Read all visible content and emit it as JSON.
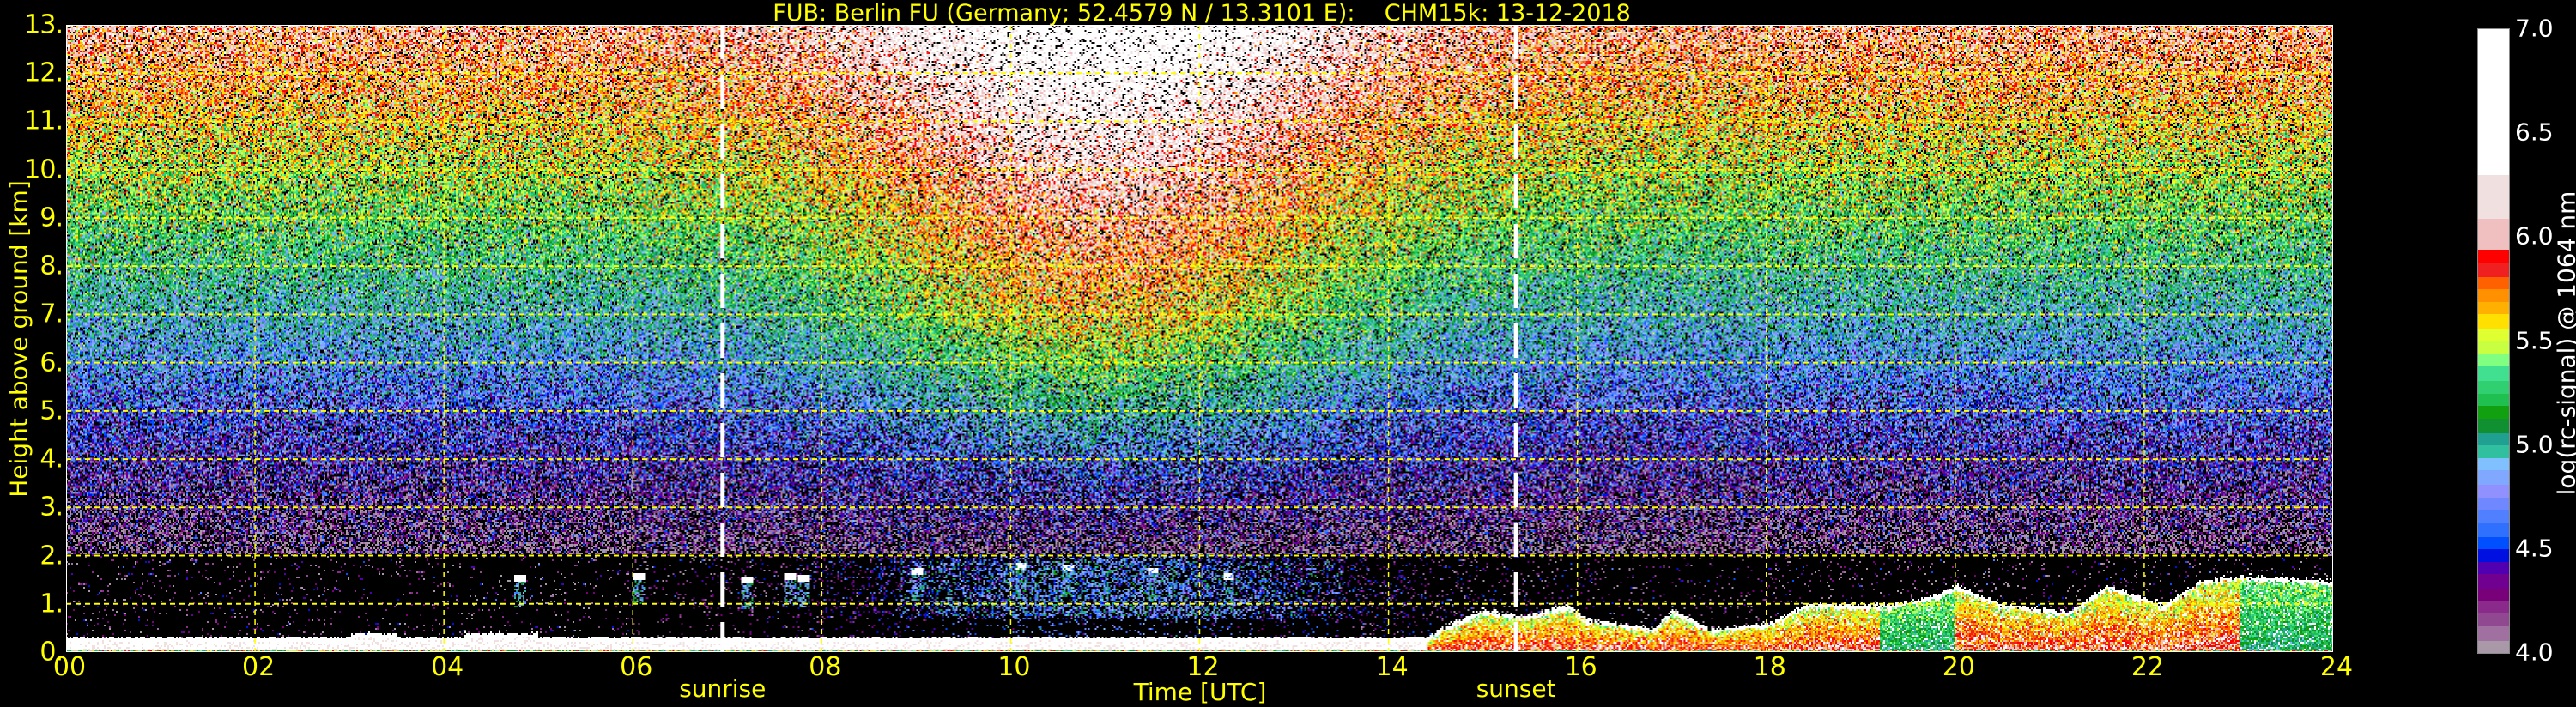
{
  "chart_data": {
    "type": "heatmap",
    "title": "FUB: Berlin FU (Germany; 52.4579 N / 13.3101 E):    CHM15k: 13-12-2018",
    "xlabel": "Time [UTC]",
    "ylabel": "Height above ground [km]",
    "xlim": [
      0,
      24
    ],
    "ylim": [
      0,
      13
    ],
    "xticks": [
      "00",
      "02",
      "04",
      "06",
      "08",
      "10",
      "12",
      "14",
      "16",
      "18",
      "20",
      "22",
      "24"
    ],
    "xtick_values": [
      0,
      2,
      4,
      6,
      8,
      10,
      12,
      14,
      16,
      18,
      20,
      22,
      24
    ],
    "yticks": [
      "0.",
      "1.",
      "2.",
      "3.",
      "4.",
      "5.",
      "6.",
      "7.",
      "8.",
      "9.",
      "10.",
      "11.",
      "12.",
      "13."
    ],
    "ytick_values": [
      0,
      1,
      2,
      3,
      4,
      5,
      6,
      7,
      8,
      9,
      10,
      11,
      12,
      13
    ],
    "grid": true,
    "grid_color": "#ffff00",
    "annotations": [
      {
        "label": "sunrise",
        "time": 6.95
      },
      {
        "label": "sunset",
        "time": 15.35
      }
    ],
    "colorbar": {
      "label": "log(rc-signal) @ 1064 nm",
      "range": [
        4.0,
        7.0
      ],
      "ticks": [
        "4.0",
        "4.5",
        "5.0",
        "5.5",
        "6.0",
        "6.5",
        "7.0"
      ],
      "tick_values": [
        4.0,
        4.5,
        5.0,
        5.5,
        6.0,
        6.5,
        7.0
      ],
      "levels": [
        {
          "from": 4.0,
          "color": "#a898a8"
        },
        {
          "from": 4.06,
          "color": "#a070a0"
        },
        {
          "from": 4.13,
          "color": "#904890"
        },
        {
          "from": 4.19,
          "color": "#8a2a8a"
        },
        {
          "from": 4.25,
          "color": "#780078"
        },
        {
          "from": 4.31,
          "color": "#700090"
        },
        {
          "from": 4.38,
          "color": "#5000b0"
        },
        {
          "from": 4.44,
          "color": "#0010e0"
        },
        {
          "from": 4.5,
          "color": "#0050ff"
        },
        {
          "from": 4.56,
          "color": "#3070ff"
        },
        {
          "from": 4.63,
          "color": "#5080ff"
        },
        {
          "from": 4.69,
          "color": "#7088ff"
        },
        {
          "from": 4.75,
          "color": "#9090ff"
        },
        {
          "from": 4.81,
          "color": "#80a8ff"
        },
        {
          "from": 4.88,
          "color": "#80c0ff"
        },
        {
          "from": 4.94,
          "color": "#30c0a0"
        },
        {
          "from": 5.0,
          "color": "#20a090"
        },
        {
          "from": 5.06,
          "color": "#109030"
        },
        {
          "from": 5.13,
          "color": "#10a010"
        },
        {
          "from": 5.19,
          "color": "#20c050"
        },
        {
          "from": 5.25,
          "color": "#30d070"
        },
        {
          "from": 5.31,
          "color": "#40e090"
        },
        {
          "from": 5.38,
          "color": "#80ff80"
        },
        {
          "from": 5.44,
          "color": "#c8ff40"
        },
        {
          "from": 5.5,
          "color": "#e0ff30"
        },
        {
          "from": 5.56,
          "color": "#ffe000"
        },
        {
          "from": 5.63,
          "color": "#ffb000"
        },
        {
          "from": 5.69,
          "color": "#ff9000"
        },
        {
          "from": 5.75,
          "color": "#ff6000"
        },
        {
          "from": 5.81,
          "color": "#f02020"
        },
        {
          "from": 5.88,
          "color": "#ff0000"
        },
        {
          "from": 5.94,
          "color": "#f0c0c0"
        },
        {
          "from": 6.09,
          "color": "#f0e0e0"
        },
        {
          "from": 6.3,
          "color": "#ffffff"
        }
      ]
    }
  }
}
